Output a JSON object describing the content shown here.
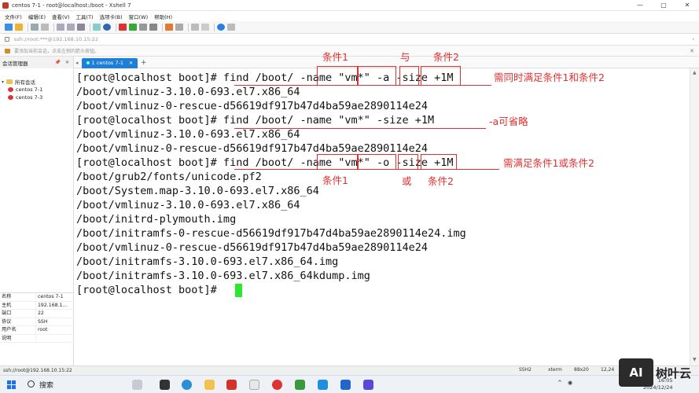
{
  "window": {
    "title": "centos 7-1 - root@localhost:/boot - Xshell 7",
    "controls": {
      "minimize": "—",
      "maximize": "▢",
      "close": "✕"
    }
  },
  "menu": [
    "文件(F)",
    "编辑(E)",
    "查看(V)",
    "工具(T)",
    "选项卡(B)",
    "窗口(W)",
    "帮助(H)"
  ],
  "address": {
    "value": "ssh://root:***@192.168.10.15:22"
  },
  "hint": {
    "text": "要添加当前会话，点击左侧的箭头按钮。"
  },
  "session_manager": {
    "title": "会话管理器",
    "buttons": "📌 ✕",
    "tree": {
      "root": "所有会话",
      "sessions": [
        "centos 7-1",
        "centos 7-3"
      ]
    },
    "properties": [
      {
        "key": "名称",
        "value": "centos 7-1"
      },
      {
        "key": "主机",
        "value": "192.168.1..."
      },
      {
        "key": "端口",
        "value": "22"
      },
      {
        "key": "协议",
        "value": "SSH"
      },
      {
        "key": "用户名",
        "value": "root"
      },
      {
        "key": "说明",
        "value": ""
      }
    ]
  },
  "tabs": [
    {
      "label": "1 centos 7-1",
      "active": true
    }
  ],
  "terminal": {
    "lines": [
      "[root@localhost boot]# find /boot/ -name \"vm*\" -a -size +1M",
      "/boot/vmlinuz-3.10.0-693.el7.x86_64",
      "/boot/vmlinuz-0-rescue-d56619df917b47d4ba59ae2890114e24",
      "[root@localhost boot]# find /boot/ -name \"vm*\" -size +1M",
      "/boot/vmlinuz-3.10.0-693.el7.x86_64",
      "/boot/vmlinuz-0-rescue-d56619df917b47d4ba59ae2890114e24",
      "[root@localhost boot]# find /boot/ -name \"vm*\" -o -size +1M",
      "/boot/grub2/fonts/unicode.pf2",
      "/boot/System.map-3.10.0-693.el7.x86_64",
      "/boot/vmlinuz-3.10.0-693.el7.x86_64",
      "/boot/initrd-plymouth.img",
      "/boot/initramfs-0-rescue-d56619df917b47d4ba59ae2890114e24.img",
      "/boot/vmlinuz-0-rescue-d56619df917b47d4ba59ae2890114e24",
      "/boot/initramfs-3.10.0-693.el7.x86_64.img",
      "/boot/initramfs-3.10.0-693.el7.x86_64kdump.img",
      "[root@localhost boot]# "
    ],
    "cursor_color": "#2ee62e"
  },
  "annotations": {
    "cond1_top": "条件1",
    "and_top": "与",
    "cond2_top": "条件2",
    "need_both": "需同时满足条件1和条件2",
    "a_optional": "-a可省略",
    "need_either": "需满足条件1或条件2",
    "cond1_bottom": "条件1",
    "or_bottom": "或",
    "cond2_bottom": "条件2",
    "color": "#e23030"
  },
  "statusbar": {
    "left": "ssh://root@192.168.10.15:22",
    "protocol": "SSH2",
    "term": "xterm",
    "size": "88x20",
    "pos": "12,24"
  },
  "taskbar": {
    "search_label": "搜索",
    "time": "16:05",
    "date": "2024/12/24"
  },
  "watermark": {
    "logo": "AI",
    "text": "树叶云"
  }
}
